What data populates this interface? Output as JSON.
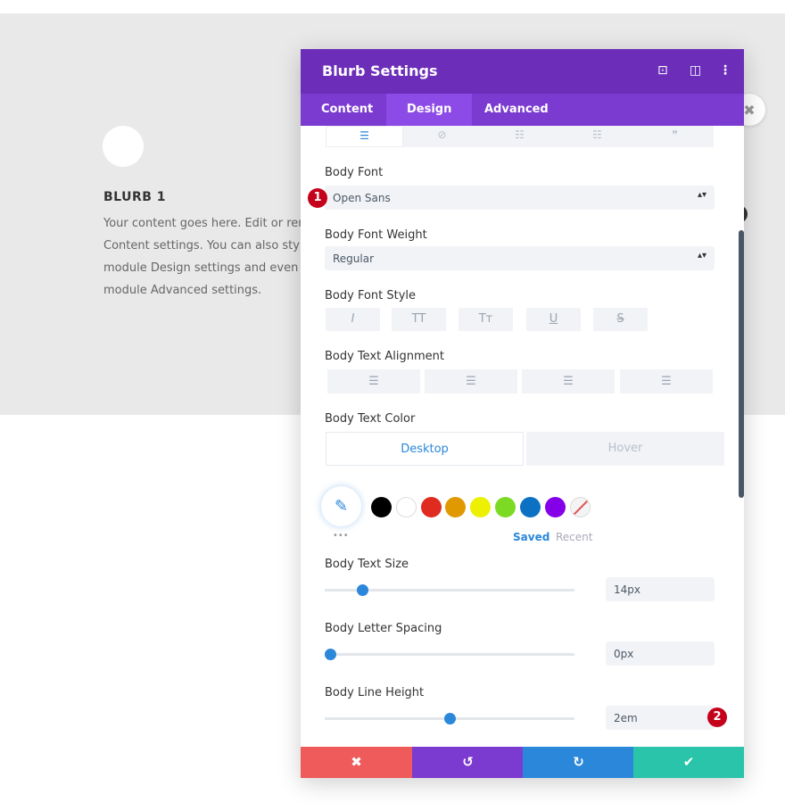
{
  "page": {
    "blurb_title": "BLURB 1",
    "blurb_lines": [
      "Your content goes here. Edit or remov",
      "Content settings. You can also style ev",
      "module Design settings and even appl",
      "module Advanced settings."
    ]
  },
  "modal": {
    "title": "Blurb Settings",
    "tabs": [
      "Content",
      "Design",
      "Advanced"
    ],
    "active_tab": "Design",
    "icons": [
      "focus-icon",
      "split-view-icon",
      "more-icon"
    ],
    "body_font": {
      "label": "Body Font",
      "value": "Open Sans"
    },
    "body_font_weight": {
      "label": "Body Font Weight",
      "value": "Regular"
    },
    "body_font_style": {
      "label": "Body Font Style",
      "buttons": [
        "I",
        "TT",
        "Tт",
        "U",
        "S"
      ]
    },
    "body_text_alignment": {
      "label": "Body Text Alignment"
    },
    "body_text_color": {
      "label": "Body Text Color",
      "tabs": [
        "Desktop",
        "Hover"
      ],
      "swatches": [
        "#000000",
        "#ffffff",
        "#e02b20",
        "#e09900",
        "#edf000",
        "#7cda24",
        "#0c71c3",
        "#8300e9"
      ],
      "saved": "Saved",
      "recent": "Recent",
      "more": "•••"
    },
    "body_text_size": {
      "label": "Body Text Size",
      "value": "14px",
      "slider_fraction": 0.15
    },
    "body_letter_spacing": {
      "label": "Body Letter Spacing",
      "value": "0px",
      "slider_fraction": 0.02
    },
    "body_line_height": {
      "label": "Body Line Height",
      "value": "2em",
      "slider_fraction": 0.5
    },
    "badges": [
      "1",
      "2"
    ],
    "footer": {
      "cancel": "✖",
      "undo": "↺",
      "redo": "↻",
      "save": "✔"
    }
  }
}
